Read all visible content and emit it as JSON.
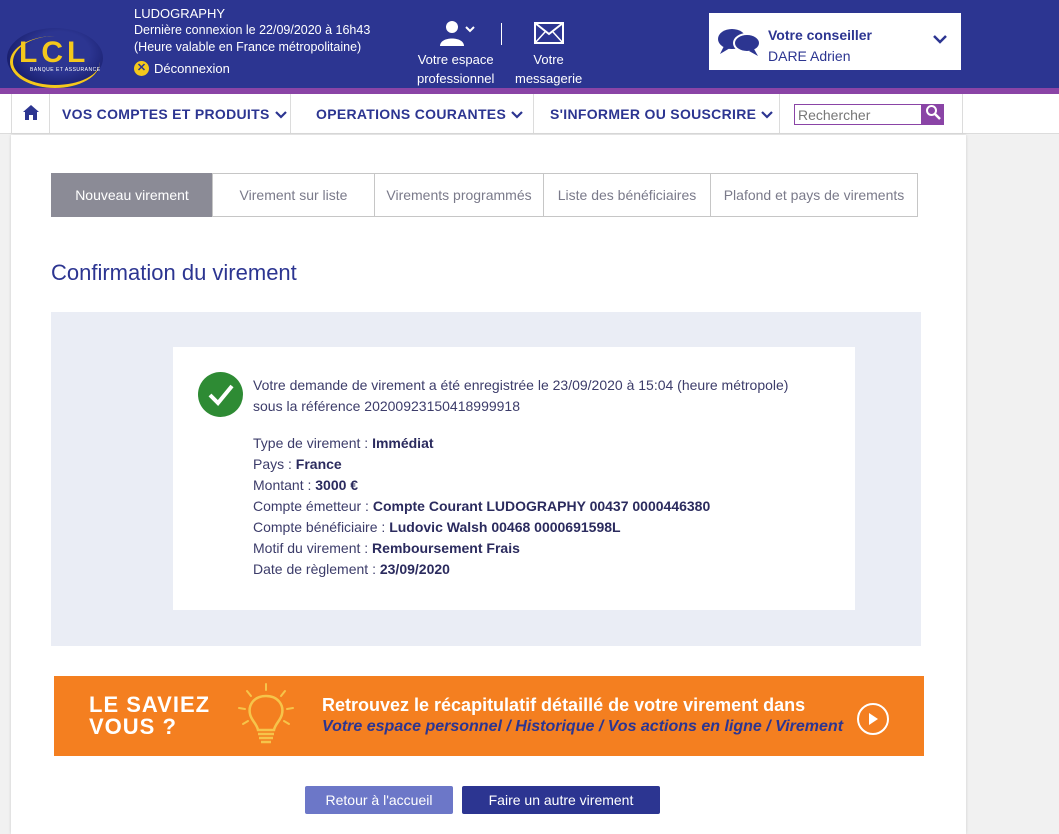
{
  "header": {
    "logo_text": "LCL",
    "logo_sub": "BANQUE ET ASSURANCE",
    "user_name": "LUDOGRAPHY",
    "last_login": "Dernière connexion le 22/09/2020 à 16h43",
    "timezone_note": "(Heure valable en France métropolitaine)",
    "logout_label": "Déconnexion",
    "pro_space_line1": "Votre espace",
    "pro_space_line2": "professionnel",
    "messaging_line1": "Votre",
    "messaging_line2": "messagerie",
    "advisor_title": "Votre conseiller",
    "advisor_name": "DARE Adrien"
  },
  "nav": {
    "items": [
      {
        "label": "VOS COMPTES ET PRODUITS"
      },
      {
        "label": "OPERATIONS COURANTES"
      },
      {
        "label": "S'INFORMER OU SOUSCRIRE"
      }
    ],
    "search_placeholder": "Rechercher"
  },
  "tabs": [
    {
      "label": "Nouveau virement",
      "active": true
    },
    {
      "label": "Virement sur liste"
    },
    {
      "label": "Virements programmés"
    },
    {
      "label": "Liste des bénéficiaires"
    },
    {
      "label": "Plafond et pays de virements"
    }
  ],
  "page_title": "Confirmation du virement",
  "confirmation": {
    "message_line1": "Votre demande de virement a été enregistrée le 23/09/2020 à 15:04 (heure métropole)",
    "message_line2": "sous la référence 20200923150418999918",
    "details": [
      {
        "label": "Type de virement : ",
        "value": "Immédiat"
      },
      {
        "label": "Pays : ",
        "value": "France"
      },
      {
        "label": "Montant : ",
        "value": "3000 €"
      },
      {
        "label": "Compte émetteur : ",
        "value": "Compte Courant LUDOGRAPHY 00437 0000446380"
      },
      {
        "label": "Compte bénéficiaire : ",
        "value": "Ludovic Walsh 00468 0000691598L"
      },
      {
        "label": "Motif du virement : ",
        "value": "Remboursement Frais"
      },
      {
        "label": "Date de règlement : ",
        "value": "23/09/2020"
      }
    ]
  },
  "banner": {
    "question_line1": "LE SAVIEZ",
    "question_line2": "VOUS ?",
    "text1": "Retrouvez le récapitulatif détaillé de votre virement dans",
    "text2": "Votre espace personnel / Historique / Vos actions en ligne / Virement"
  },
  "buttons": {
    "home": "Retour à l'accueil",
    "new_transfer": "Faire un autre virement"
  },
  "colors": {
    "brand": "#2c3591",
    "accent": "#8a44a6",
    "banner": "#f47f20",
    "success": "#2e8b34"
  }
}
